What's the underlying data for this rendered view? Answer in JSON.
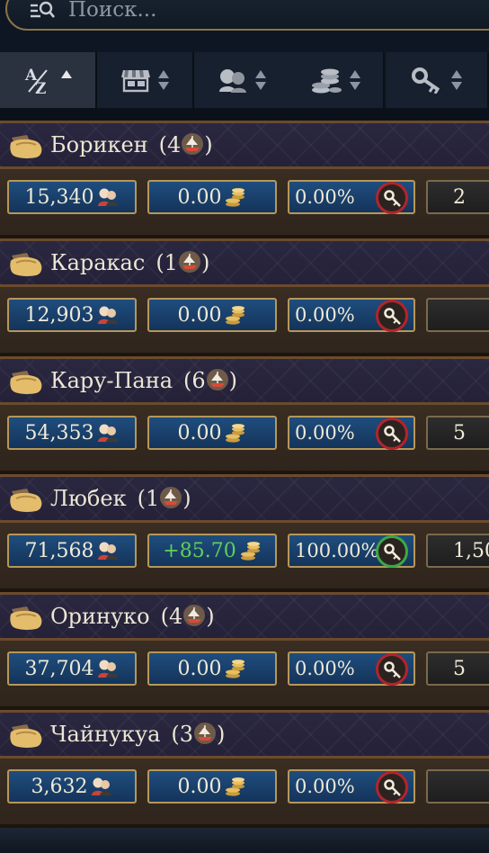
{
  "search": {
    "placeholder": "Поиск..."
  },
  "sort": {
    "buttons": [
      {
        "key": "name",
        "icon": "alpha-sort-icon",
        "active": true
      },
      {
        "key": "market",
        "icon": "market-stall-icon",
        "active": false
      },
      {
        "key": "population",
        "icon": "people-icon",
        "active": false
      },
      {
        "key": "money",
        "icon": "coins-icon",
        "active": false
      },
      {
        "key": "access",
        "icon": "key-icon",
        "active": false
      }
    ]
  },
  "colonies": [
    {
      "name": "Борикен",
      "ships": "(4",
      "ships_close": ")",
      "population": "15,340",
      "income": "0.00",
      "share": "0.00%",
      "access": false,
      "extra": "2"
    },
    {
      "name": "Каракас",
      "ships": "(1",
      "ships_close": ")",
      "population": "12,903",
      "income": "0.00",
      "share": "0.00%",
      "access": false,
      "extra": ""
    },
    {
      "name": "Кару-Пана",
      "ships": "(6",
      "ships_close": ")",
      "population": "54,353",
      "income": "0.00",
      "share": "0.00%",
      "access": false,
      "extra": "5"
    },
    {
      "name": "Любек",
      "ships": "(1",
      "ships_close": ")",
      "population": "71,568",
      "income": "+85.70",
      "share": "100.00%",
      "access": true,
      "extra": "1,50"
    },
    {
      "name": "Оринуко",
      "ships": "(4",
      "ships_close": ")",
      "population": "37,704",
      "income": "0.00",
      "share": "0.00%",
      "access": false,
      "extra": "5"
    },
    {
      "name": "Чайнукуа",
      "ships": "(3",
      "ships_close": ")",
      "population": "3,632",
      "income": "0.00",
      "share": "0.00%",
      "access": false,
      "extra": ""
    }
  ],
  "colors": {
    "positive": "#5fd05a",
    "denied": "#b3242b",
    "granted": "#3ca845",
    "gold_border": "#b6975a"
  }
}
